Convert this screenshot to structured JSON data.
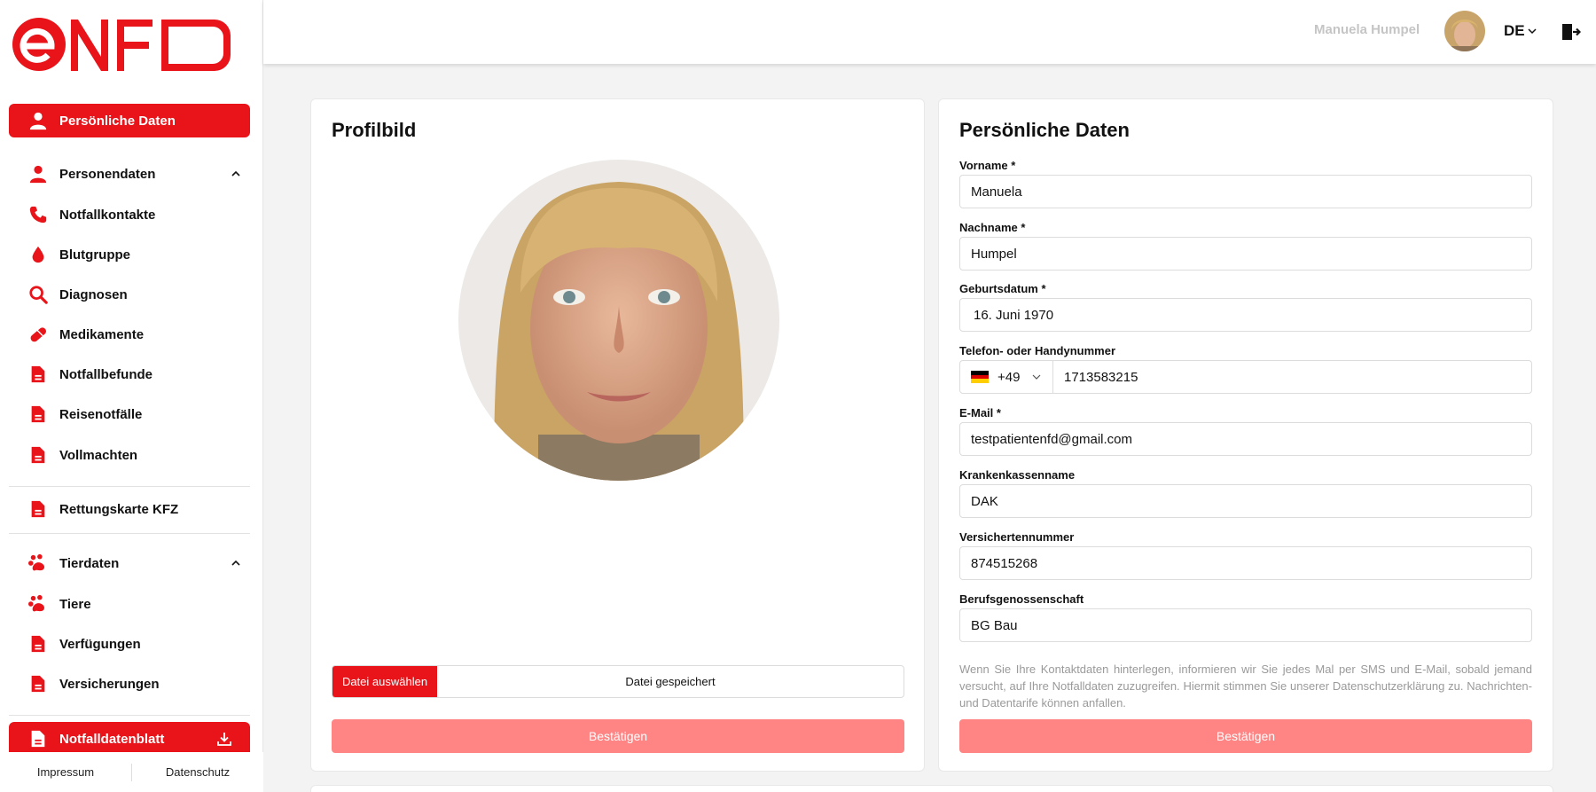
{
  "brand": {
    "logo_text": "eNFD",
    "accent": "#e8141a"
  },
  "sidebar": {
    "active_item": {
      "label": "Persönliche Daten",
      "icon": "person-icon"
    },
    "groups": [
      {
        "label": "Personendaten",
        "icon": "person-icon",
        "expanded": true
      },
      {
        "label": "Tierdaten",
        "icon": "paw-icon",
        "expanded": true
      }
    ],
    "items": [
      {
        "label": "Notfallkontakte",
        "icon": "phone-icon"
      },
      {
        "label": "Blutgruppe",
        "icon": "blood-drop-icon"
      },
      {
        "label": "Diagnosen",
        "icon": "search-icon"
      },
      {
        "label": "Medikamente",
        "icon": "pill-icon"
      },
      {
        "label": "Notfallbefunde",
        "icon": "document-icon"
      },
      {
        "label": "Reisenotfälle",
        "icon": "document-icon"
      },
      {
        "label": "Vollmachten",
        "icon": "document-icon"
      },
      {
        "label": "Rettungskarte KFZ",
        "icon": "document-icon"
      },
      {
        "label": "Tiere",
        "icon": "paw-icon"
      },
      {
        "label": "Verfügungen",
        "icon": "document-icon"
      },
      {
        "label": "Versicherungen",
        "icon": "document-icon"
      }
    ],
    "bottom_item": {
      "label": "Notfalldatenblatt",
      "icon": "document-icon",
      "action_icon": "download-icon"
    },
    "footer": {
      "impressum": "Impressum",
      "datenschutz": "Datenschutz"
    }
  },
  "header": {
    "user_name": "Manuela Humpel",
    "language": "DE",
    "logout_icon": "logout-icon"
  },
  "profile_card": {
    "title": "Profilbild",
    "file_button": "Datei auswählen",
    "file_status": "Datei gespeichert",
    "confirm": "Bestätigen"
  },
  "personal_card": {
    "title": "Persönliche Daten",
    "fields": {
      "firstname": {
        "label": "Vorname *",
        "value": "Manuela"
      },
      "lastname": {
        "label": "Nachname *",
        "value": "Humpel"
      },
      "birthdate": {
        "label": "Geburtsdatum *",
        "value": "16. Juni 1970"
      },
      "phone": {
        "label": "Telefon- oder Handynummer",
        "country_code": "+49",
        "value": "1713583215"
      },
      "email": {
        "label": "E-Mail *",
        "value": "testpatientenfd@gmail.com"
      },
      "insurer": {
        "label": "Krankenkassenname",
        "value": "DAK"
      },
      "insurance_number": {
        "label": "Versichertennummer",
        "value": "874515268"
      },
      "trade_association": {
        "label": "Berufsgenossenschaft",
        "value": "BG Bau"
      }
    },
    "notice": "Wenn Sie Ihre Kontaktdaten hinterlegen, informieren wir Sie jedes Mal per SMS und E-Mail, sobald jemand versucht, auf Ihre Notfalldaten zuzugreifen. Hiermit stimmen Sie unserer Datenschutzerklärung zu. Nachrichten- und Datentarife können anfallen.",
    "confirm": "Bestätigen"
  }
}
